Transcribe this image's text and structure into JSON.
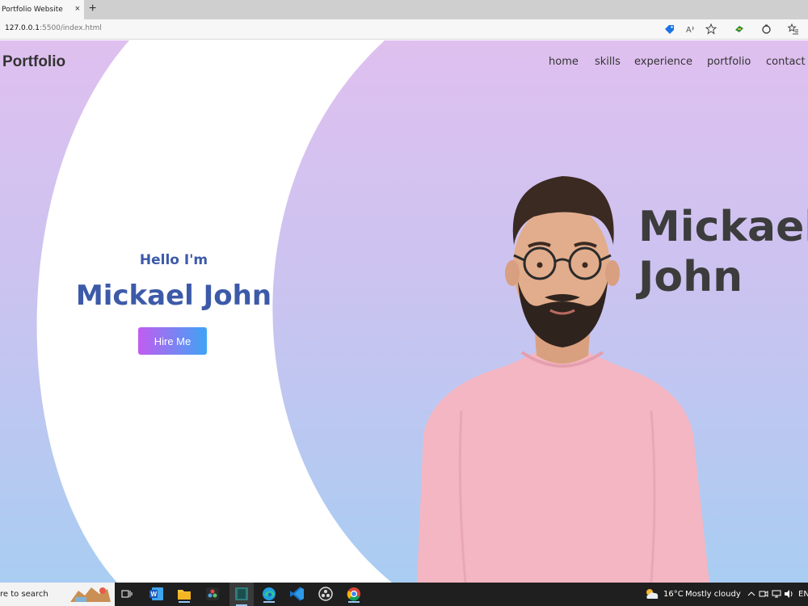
{
  "browser": {
    "tab_title": "Portfolio Website",
    "tab_close": "×",
    "new_tab": "+",
    "url_host": "127.0.0.1",
    "url_rest": ":5500/index.html"
  },
  "site": {
    "brand": "Portfolio",
    "nav": [
      "home",
      "skills",
      "experience",
      "portfolio",
      "contact"
    ],
    "hello": "Hello I'm",
    "hero_name": "Mickael John",
    "hire_label": "Hire Me",
    "big_name_line1": "Mickael",
    "big_name_line2": "John"
  },
  "taskbar": {
    "search_text": "re to search",
    "temperature": "16°C",
    "weather": "Mostly cloudy",
    "lang": "EN"
  },
  "colors": {
    "accent_blue": "#3d5aa9",
    "button_gradient_start": "#c25cf0",
    "button_gradient_end": "#3fa4f5",
    "sweater": "#f4b6c2"
  }
}
